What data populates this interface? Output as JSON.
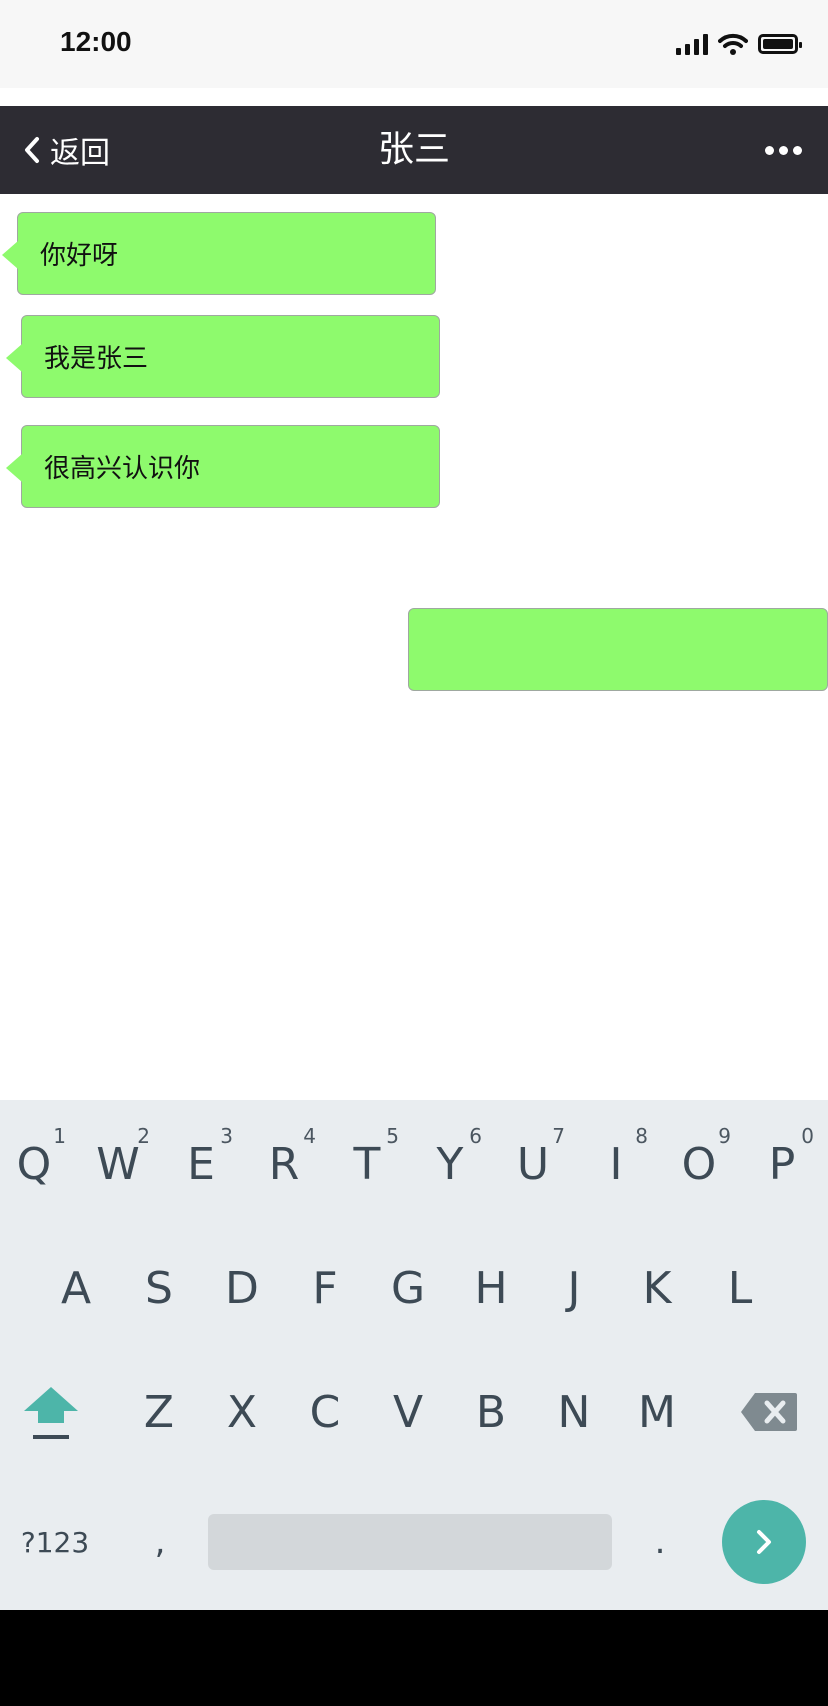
{
  "status_bar": {
    "time": "12:00"
  },
  "nav": {
    "back_label": "返回",
    "title": "张三"
  },
  "messages": [
    {
      "direction": "incoming",
      "text": "你好呀"
    },
    {
      "direction": "incoming",
      "text": "我是张三"
    },
    {
      "direction": "incoming",
      "text": "很高兴认识你"
    },
    {
      "direction": "outgoing",
      "text": ""
    }
  ],
  "colors": {
    "bubble": "#8efa6d",
    "nav_background": "#2d2c33",
    "keyboard_background": "#e9edf0",
    "accent": "#4db5a9"
  },
  "keyboard": {
    "row1": [
      {
        "key": "Q",
        "num": "1"
      },
      {
        "key": "W",
        "num": "2"
      },
      {
        "key": "E",
        "num": "3"
      },
      {
        "key": "R",
        "num": "4"
      },
      {
        "key": "T",
        "num": "5"
      },
      {
        "key": "Y",
        "num": "6"
      },
      {
        "key": "U",
        "num": "7"
      },
      {
        "key": "I",
        "num": "8"
      },
      {
        "key": "O",
        "num": "9"
      },
      {
        "key": "P",
        "num": "0"
      }
    ],
    "row2": [
      "A",
      "S",
      "D",
      "F",
      "G",
      "H",
      "J",
      "K",
      "L"
    ],
    "row3": [
      "Z",
      "X",
      "C",
      "V",
      "B",
      "N",
      "M"
    ],
    "symbols_label": "?123",
    "comma_label": ",",
    "period_label": ".",
    "icons": {
      "shift": "shift-arrow-icon",
      "backspace": "backspace-icon",
      "enter": "chevron-right-icon"
    }
  }
}
